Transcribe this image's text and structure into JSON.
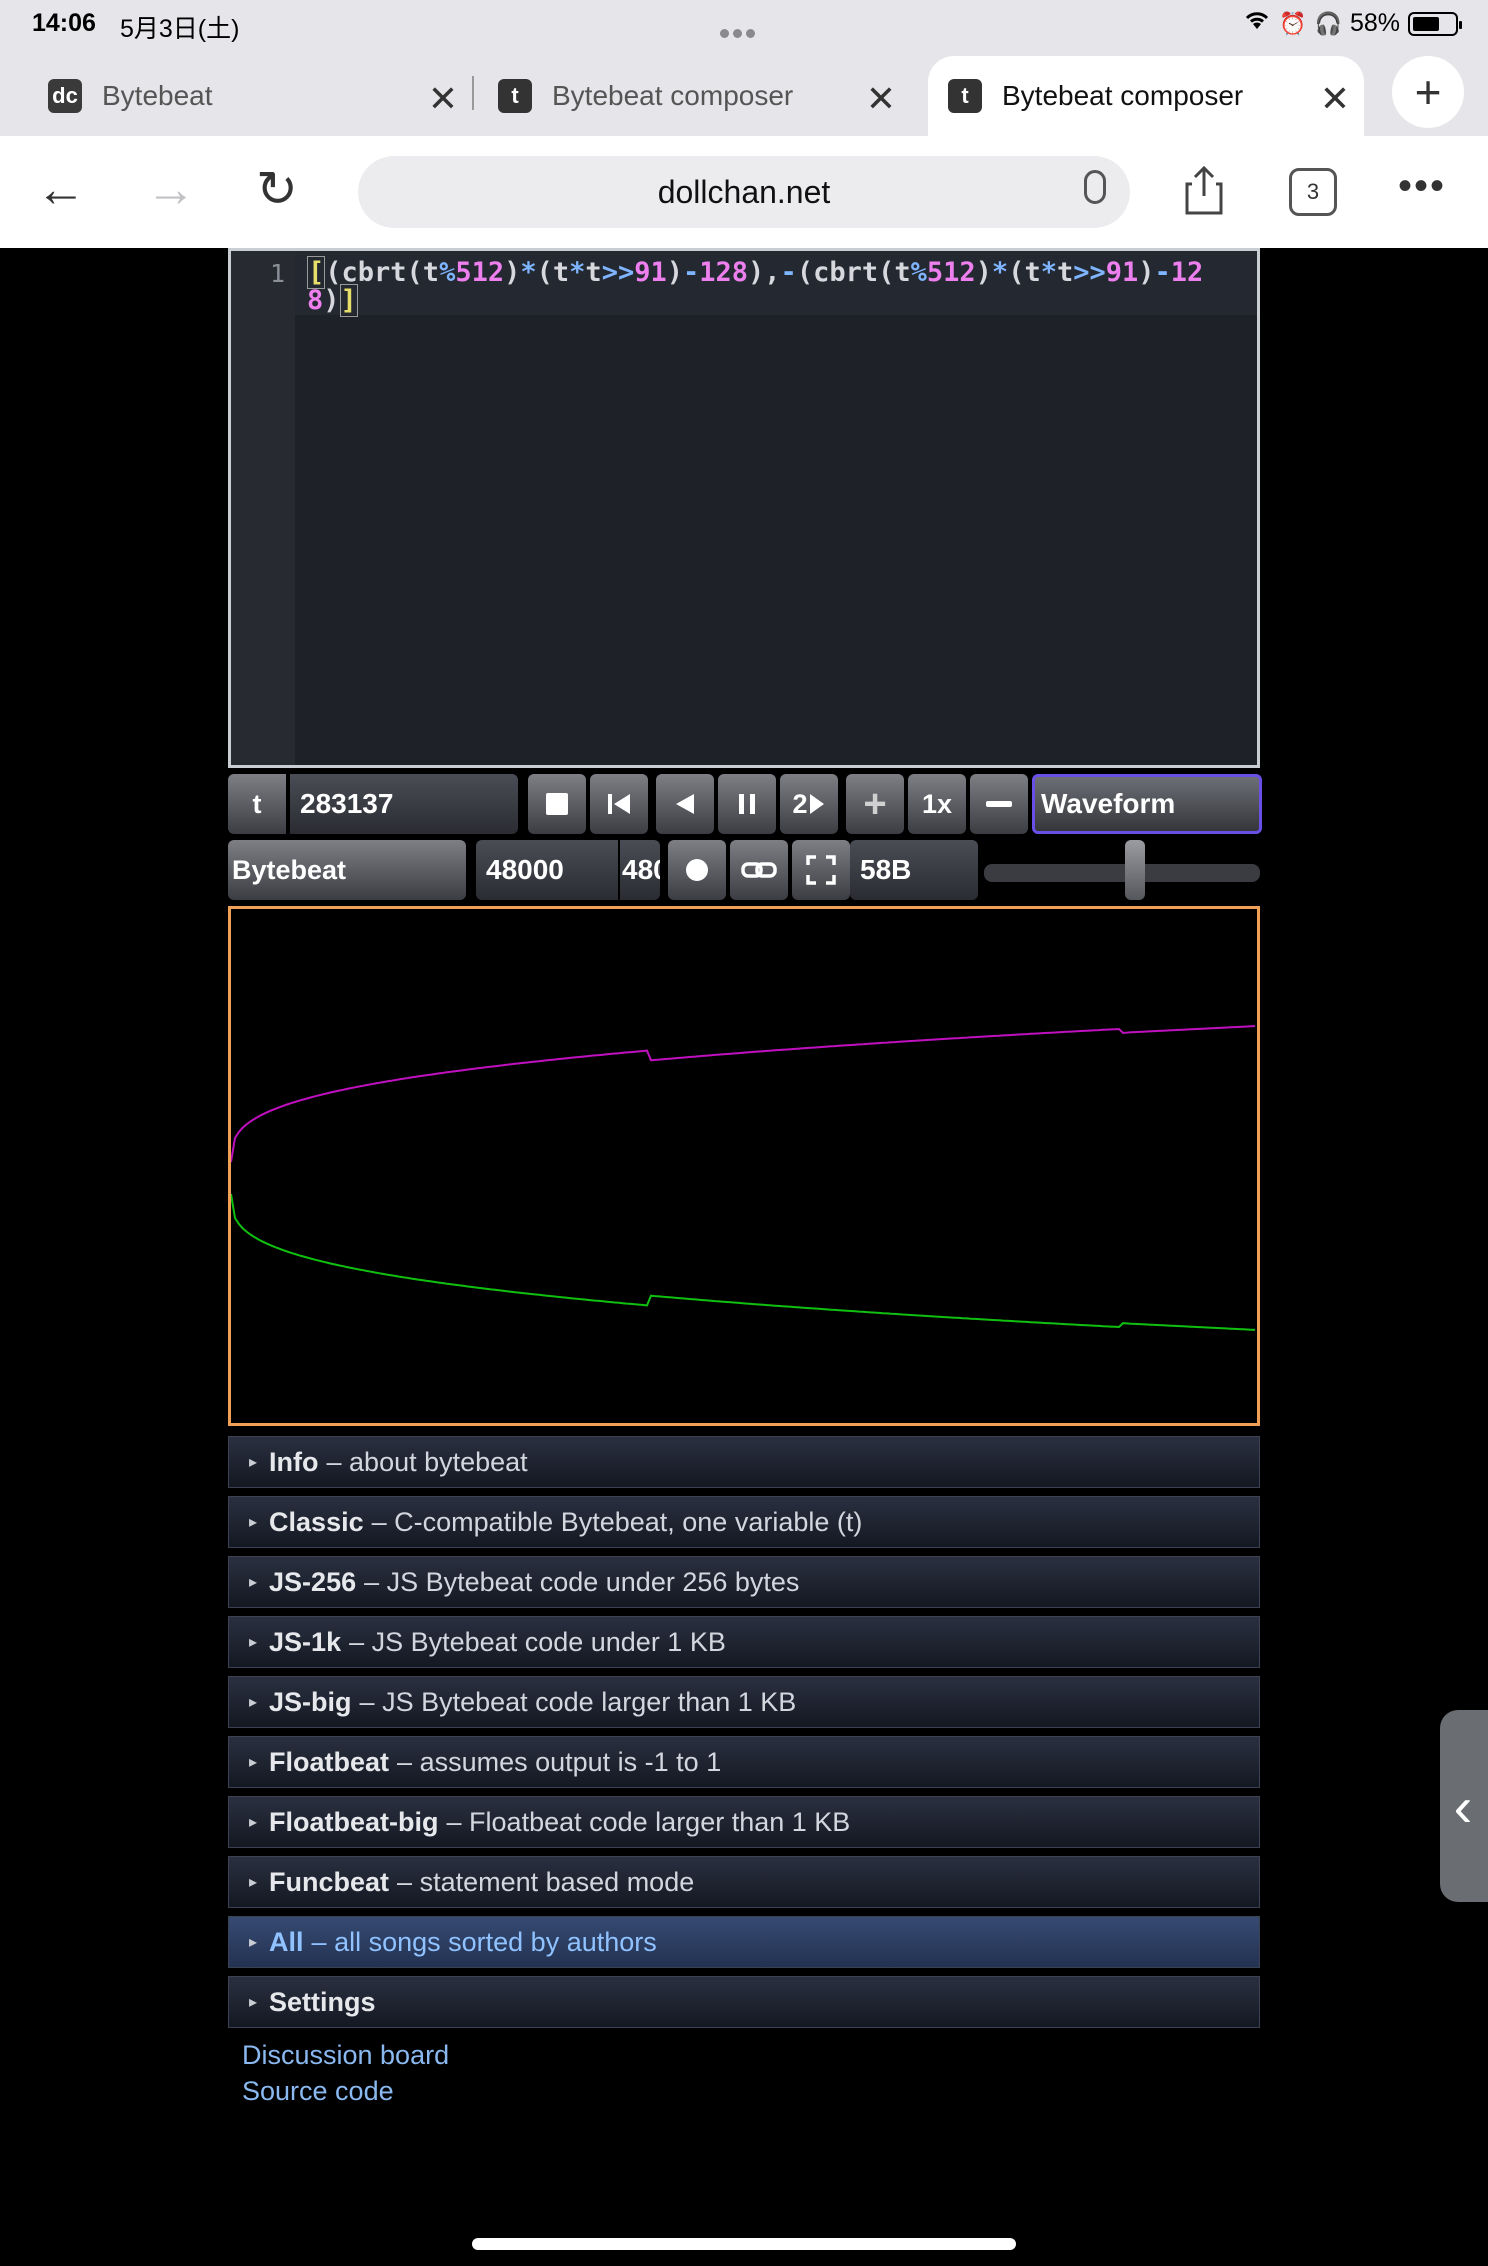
{
  "status": {
    "time": "14:06",
    "date": "5月3日(土)",
    "battery": "58%"
  },
  "tabs": [
    {
      "title": "Bytebeat",
      "icon": "dc-favicon",
      "active": false
    },
    {
      "title": "Bytebeat composer",
      "icon": "t-favicon",
      "active": false
    },
    {
      "title": "Bytebeat composer",
      "icon": "t-favicon",
      "active": true
    }
  ],
  "browser": {
    "url": "dollchan.net",
    "tab_count": "3"
  },
  "editor": {
    "line_number": "1",
    "code": "[(cbrt(t%512)*(t*t>>91)-128),-(cbrt(t%512)*(t*t>>91)-128)]"
  },
  "controls": {
    "t_label": "t",
    "t_value": "283137",
    "speed_num": "2",
    "zoom": "1x",
    "view_mode": "Waveform",
    "mode": "Bytebeat",
    "sample_rate": "48000",
    "sample_rate_tail": "480",
    "size": "58B",
    "volume_level": 0.55
  },
  "waveform": {
    "series_colors": {
      "left": "#c010c0",
      "right": "#10c010"
    }
  },
  "library": [
    {
      "name": "Info",
      "desc": " – about bytebeat"
    },
    {
      "name": "Classic",
      "desc": " – C-compatible Bytebeat, one variable (t)"
    },
    {
      "name": "JS-256",
      "desc": " – JS Bytebeat code under 256 bytes"
    },
    {
      "name": "JS-1k",
      "desc": " – JS Bytebeat code under 1 KB"
    },
    {
      "name": "JS-big",
      "desc": " – JS Bytebeat code larger than 1 KB"
    },
    {
      "name": "Floatbeat",
      "desc": " – assumes output is -1 to 1"
    },
    {
      "name": "Floatbeat-big",
      "desc": " – Floatbeat code larger than 1 KB"
    },
    {
      "name": "Funcbeat",
      "desc": " – statement based mode"
    },
    {
      "name": "All",
      "desc": " – all songs sorted by authors"
    },
    {
      "name": "Settings",
      "desc": ""
    }
  ],
  "links": {
    "discussion": "Discussion board",
    "source": "Source code"
  }
}
